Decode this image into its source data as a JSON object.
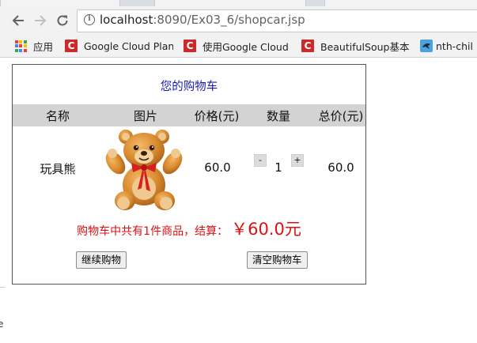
{
  "browser": {
    "url_host": "localhost",
    "url_rest": ":8090/Ex03_6/shopcar.jsp",
    "bookmarks": [
      {
        "label": "应用",
        "icon": "apps-grid-icon"
      },
      {
        "label": "Google Cloud Plan",
        "icon": "c-logo-icon"
      },
      {
        "label": "使用Google Cloud",
        "icon": "c-logo-icon"
      },
      {
        "label": "BeautifulSoup基本",
        "icon": "c-logo-icon"
      },
      {
        "label": "nth-chil",
        "icon": "bird-icon"
      }
    ]
  },
  "cart": {
    "title": "您的购物车",
    "columns": [
      "名称",
      "图片",
      "价格(元)",
      "数量",
      "总价(元)"
    ],
    "items": [
      {
        "name": "玩具熊",
        "image": "teddy-bear",
        "price": "60.0",
        "quantity": "1",
        "total": "60.0",
        "minus_label": "-",
        "plus_label": "+"
      }
    ],
    "summary_text": "购物车中共有1件商品，结算：",
    "summary_total": "￥60.0元",
    "continue_label": "继续购物",
    "clear_label": "清空购物车"
  },
  "colors": {
    "title": "#1a1ab0",
    "summary": "#dd1111",
    "header_bg": "#d3d3d3"
  },
  "edge_fragment": "e"
}
